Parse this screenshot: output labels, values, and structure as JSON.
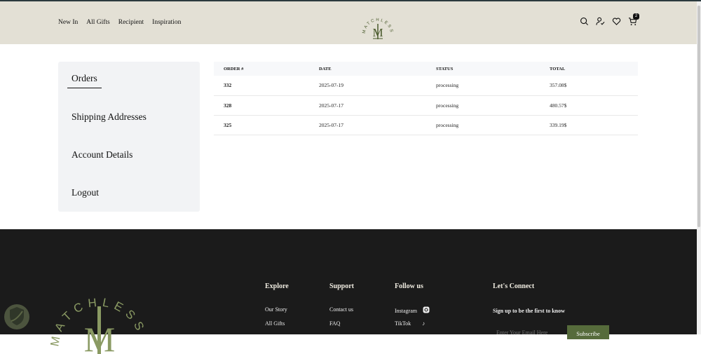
{
  "header": {
    "nav": [
      "New In",
      "All Gifts",
      "Recipient",
      "Inspiration"
    ],
    "logo_text": "MATCHLESS",
    "cart_count": "2"
  },
  "sidebar": {
    "items": [
      "Orders",
      "Shipping Addresses",
      "Account Details",
      "Logout"
    ]
  },
  "orders": {
    "columns": [
      "ORDER #",
      "DATE",
      "STATUS",
      "TOTAL"
    ],
    "rows": [
      [
        "332",
        "2025-07-19",
        "processing",
        "357.08$"
      ],
      [
        "328",
        "2025-07-17",
        "processing",
        "480.57$"
      ],
      [
        "325",
        "2025-07-17",
        "processing",
        "339.19$"
      ]
    ]
  },
  "footer": {
    "logo_text": "MATCHLESS",
    "explore": {
      "title": "Explore",
      "links": [
        "Our Story",
        "All Gifts"
      ]
    },
    "support": {
      "title": "Support",
      "links": [
        "Contact us",
        "FAQ"
      ]
    },
    "follow": {
      "title": "Follow us",
      "links": [
        "Instagram",
        "TikTok"
      ]
    },
    "connect": {
      "title": "Let's Connect",
      "subtitle": "Sign up to be the first to know",
      "placeholder": "Enter Your Email Here",
      "button": "Subscribe"
    }
  },
  "colors": {
    "header_bg": "#e3e0d5",
    "brand_green": "#566b3b",
    "footer_bg": "#1b1b1b"
  }
}
